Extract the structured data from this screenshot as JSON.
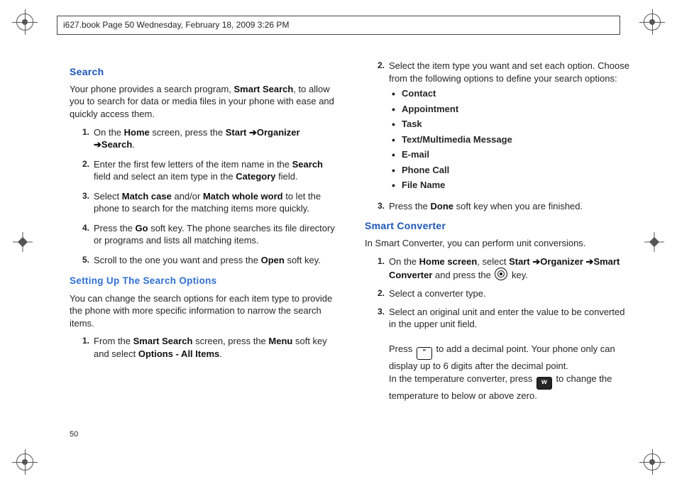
{
  "header": "i627.book  Page 50  Wednesday, February 18, 2009  3:26 PM",
  "page_number": "50",
  "left": {
    "h_search": "Search",
    "intro_a": "Your phone provides a search program, ",
    "intro_b": "Smart Search",
    "intro_c": ", to allow you to search for data or media files in your phone with ease and quickly access them.",
    "s1_a": "On the ",
    "s1_b": "Home",
    "s1_c": " screen, press the ",
    "s1_d": "Start",
    "s1_e": "Organizer",
    "s1_f": "Search",
    "s1_g": ".",
    "s2_a": "Enter the first few letters of the item name in the ",
    "s2_b": "Search",
    "s2_c": " field and select an item type in the ",
    "s2_d": "Category",
    "s2_e": " field.",
    "s3_a": "Select ",
    "s3_b": "Match case",
    "s3_c": " and/or ",
    "s3_d": "Match whole word",
    "s3_e": " to let the phone to search for the matching items more quickly.",
    "s4_a": "Press the ",
    "s4_b": "Go",
    "s4_c": " soft key. The phone searches its file directory or programs and lists all matching items.",
    "s5_a": "Scroll to the one you want and press the ",
    "s5_b": "Open",
    "s5_c": " soft key.",
    "h_setup": "Setting Up The Search Options",
    "setup_p": "You can change the search options for each item type to provide the phone with more specific information to narrow the search items.",
    "so1_a": "From the ",
    "so1_b": "Smart Search",
    "so1_c": " screen, press the ",
    "so1_d": "Menu",
    "so1_e": " soft key and select ",
    "so1_f": "Options - All Items",
    "so1_g": "."
  },
  "right": {
    "r2_a": "Select the item type you want and set each option. Choose from the following options to define your search options:",
    "opts": {
      "o1": "Contact",
      "o2": "Appointment",
      "o3": "Task",
      "o4": "Text/Multimedia Message",
      "o5": "E-mail",
      "o6": "Phone Call",
      "o7": "File Name"
    },
    "r3_a": "Press the ",
    "r3_b": "Done",
    "r3_c": " soft key when you are finished.",
    "h_conv": "Smart Converter",
    "conv_p": "In Smart Converter, you can perform unit conversions.",
    "c1_a": "On the ",
    "c1_b": "Home screen",
    "c1_c": ", select ",
    "c1_d": "Start",
    "c1_e": "Organizer",
    "c1_f": "Smart Converter",
    "c1_g": " and press the ",
    "c1_h": " key.",
    "c2": "Select a converter type.",
    "c3_a": "Select an original unit and enter the value to be converted in the upper unit field.",
    "c3_b1": "Press ",
    "c3_b2": " to add a decimal point. Your phone only can display up to 6 digits after the decimal point.",
    "c3_c1": "In the temperature converter, press ",
    "c3_c2": " to change the temperature to below or above zero.",
    "key_quote": "\"",
    "key_w": "w"
  },
  "nums": {
    "n1": "1.",
    "n2": "2.",
    "n3": "3.",
    "n4": "4.",
    "n5": "5."
  }
}
